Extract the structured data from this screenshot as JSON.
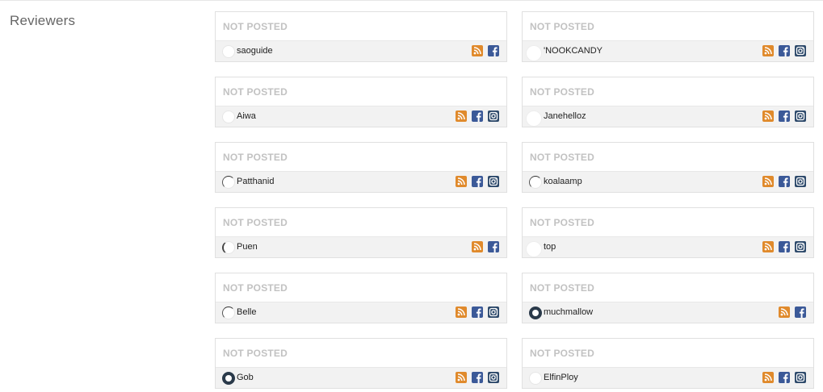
{
  "section": {
    "title": "Reviewers"
  },
  "colors": {
    "rss": "#e08a2c",
    "facebook": "#3b5998",
    "instagram": "#2e4a6b",
    "status": "#c2c2c2"
  },
  "icons": {
    "rss": "rss-icon",
    "facebook": "facebook-icon",
    "instagram": "instagram-icon"
  },
  "reviewers": [
    {
      "status": "NOT POSTED",
      "name": "saoguide",
      "socials": [
        "rss",
        "facebook"
      ],
      "avatar": "plain"
    },
    {
      "status": "NOT POSTED",
      "name": "'NOOKCANDY",
      "socials": [
        "rss",
        "facebook",
        "instagram"
      ],
      "avatar": "big"
    },
    {
      "status": "NOT POSTED",
      "name": "Aiwa",
      "socials": [
        "rss",
        "facebook",
        "instagram"
      ],
      "avatar": "plain"
    },
    {
      "status": "NOT POSTED",
      "name": "Janehelloz",
      "socials": [
        "rss",
        "facebook",
        "instagram"
      ],
      "avatar": "big"
    },
    {
      "status": "NOT POSTED",
      "name": "Patthanid",
      "socials": [
        "rss",
        "facebook",
        "instagram"
      ],
      "avatar": "spin"
    },
    {
      "status": "NOT POSTED",
      "name": "koalaamp",
      "socials": [
        "rss",
        "facebook",
        "instagram"
      ],
      "avatar": "spin"
    },
    {
      "status": "NOT POSTED",
      "name": "Puen",
      "socials": [
        "rss",
        "facebook"
      ],
      "avatar": "half"
    },
    {
      "status": "NOT POSTED",
      "name": "top",
      "socials": [
        "rss",
        "facebook",
        "instagram"
      ],
      "avatar": "big"
    },
    {
      "status": "NOT POSTED",
      "name": "Belle",
      "socials": [
        "rss",
        "facebook",
        "instagram"
      ],
      "avatar": "spin"
    },
    {
      "status": "NOT POSTED",
      "name": "muchmallow",
      "socials": [
        "rss",
        "facebook"
      ],
      "avatar": "logo"
    },
    {
      "status": "NOT POSTED",
      "name": "Gob",
      "socials": [
        "rss",
        "facebook",
        "instagram"
      ],
      "avatar": "logo"
    },
    {
      "status": "NOT POSTED",
      "name": "ElfinPloy",
      "socials": [
        "rss",
        "facebook",
        "instagram"
      ],
      "avatar": "plain"
    }
  ]
}
